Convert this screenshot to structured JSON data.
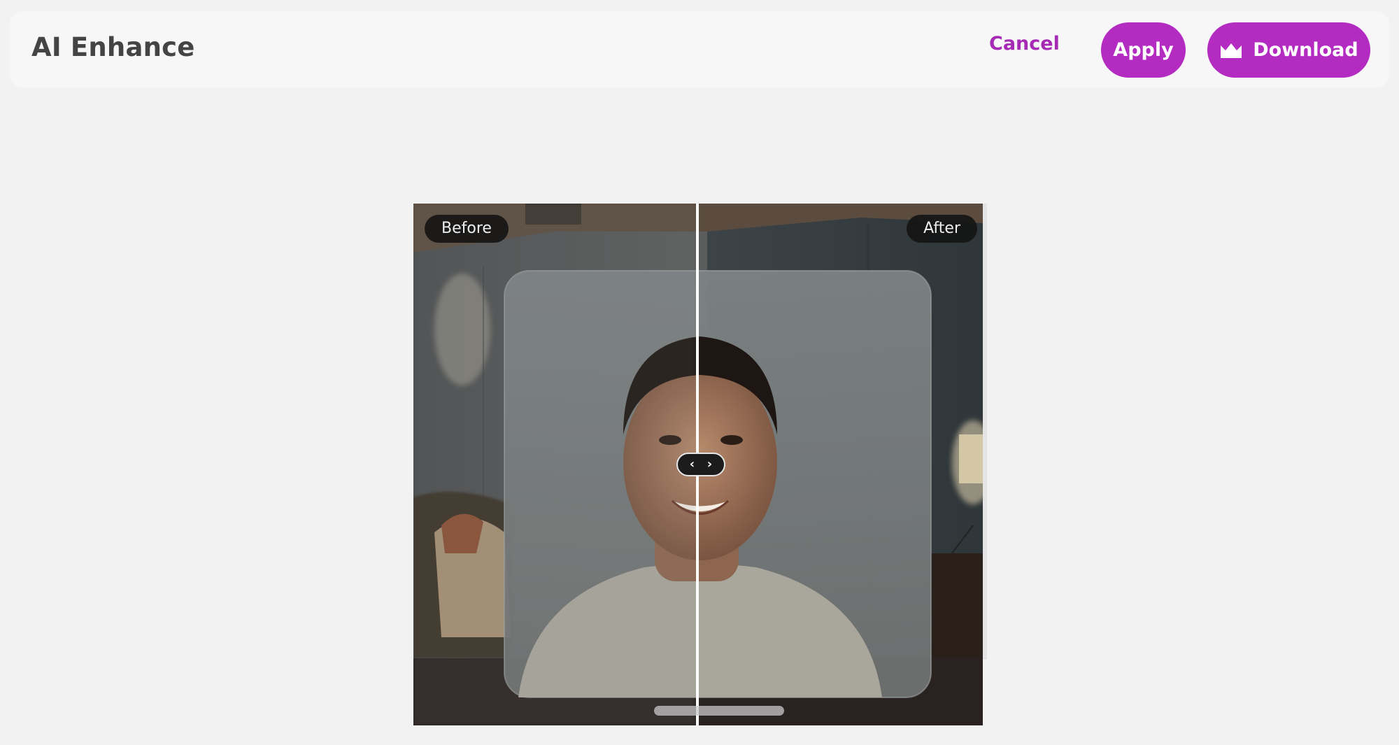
{
  "header": {
    "title": "AI Enhance",
    "cancel_label": "Cancel",
    "apply_label": "Apply",
    "download_label": "Download"
  },
  "compare": {
    "before_label": "Before",
    "after_label": "After",
    "handle_left": "‹",
    "handle_right": "›"
  },
  "colors": {
    "accent": "#b42bc2",
    "cancel_text": "#a52ab4",
    "page_bg": "#f2f2f2",
    "header_bg": "#f7f7f7"
  },
  "icons": {
    "download": "crown-icon",
    "handle_left": "chevron-left-icon",
    "handle_right": "chevron-right-icon"
  }
}
